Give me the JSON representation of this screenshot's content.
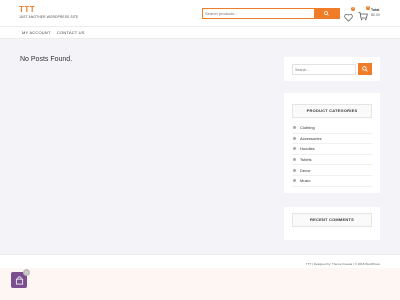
{
  "site": {
    "title": "TTT",
    "tagline": "JUST ANOTHER WORDPRESS SITE"
  },
  "header": {
    "search_placeholder": "Search products...",
    "wishlist_count": "0",
    "cart_count": "0",
    "cart_total_label": "Total",
    "cart_total_amount": "$0.00"
  },
  "nav": {
    "items": [
      {
        "label": "MY ACCOUNT"
      },
      {
        "label": "CONTACT US"
      }
    ]
  },
  "main": {
    "message": "No Posts Found."
  },
  "sidebar": {
    "search_placeholder": "Search ...",
    "categories_title": "PRODUCT CATEGORIES",
    "categories": [
      {
        "label": "Clothing"
      },
      {
        "label": "Accessories"
      },
      {
        "label": "Hoodies"
      },
      {
        "label": "Tshirts"
      },
      {
        "label": "Decor"
      },
      {
        "label": "Music"
      }
    ],
    "recent_comments_title": "RECENT COMMENTS"
  },
  "footer": {
    "credit": "TTT | Designed by: Theme Freesia | © 2018 WordPress"
  },
  "floating_cart": {
    "count": "0"
  },
  "colors": {
    "accent": "#f07c28",
    "floating_cart": "#7b4f8e"
  }
}
